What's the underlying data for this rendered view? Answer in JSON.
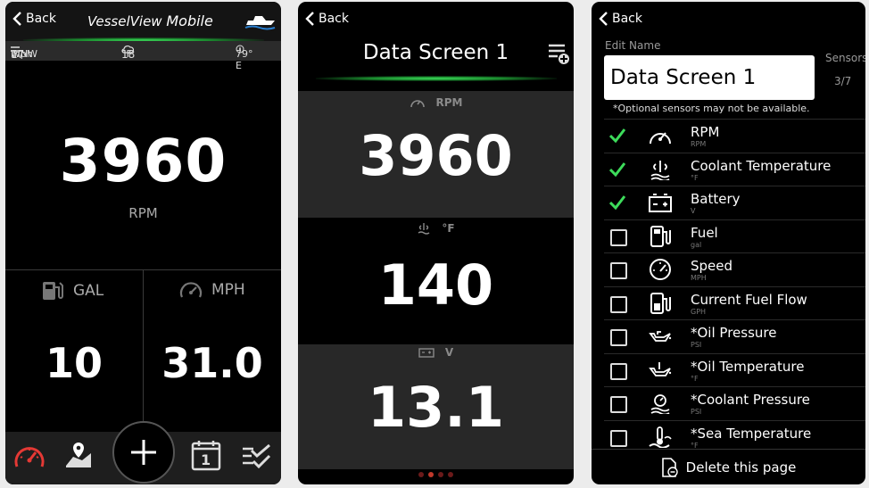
{
  "colors": {
    "accent_green": "#3ddc5b",
    "gauge_red": "#e53935",
    "dot_active": "#c0392b"
  },
  "panel1": {
    "back_label": "Back",
    "brand": {
      "part1": "VesselView",
      "part2": "Mobile"
    },
    "weather": {
      "wind": "17",
      "wind_unit": "mph",
      "wind_dir": "WNW",
      "air_temp": "18",
      "air_unit": "°F",
      "heading": "79° E"
    },
    "main": {
      "value": "3960",
      "unit": "RPM"
    },
    "left": {
      "label": "GAL",
      "value": "10"
    },
    "right": {
      "label": "MPH",
      "value": "31.0"
    },
    "toolbar_icons": [
      "gauge-icon",
      "map-pin-icon",
      "add-icon",
      "calendar-icon",
      "checklist-icon"
    ],
    "calendar_day": "1"
  },
  "panel2": {
    "back_label": "Back",
    "title": "Data Screen 1",
    "blocks": [
      {
        "label": "RPM",
        "value": "3960",
        "icon": "gauge-icon"
      },
      {
        "label": "°F",
        "value": "140",
        "icon": "coolant-temp-icon"
      },
      {
        "label": "V",
        "value": "13.1",
        "icon": "battery-icon"
      }
    ],
    "page_dots": 4,
    "active_dot": 1
  },
  "panel3": {
    "back_label": "Back",
    "edit_label": "Edit Name",
    "name_value": "Data Screen 1",
    "sensors_label": "Sensors",
    "sensors_count": "3/7",
    "note": "*Optional sensors may not be available.",
    "sensors": [
      {
        "name": "RPM",
        "unit": "RPM",
        "checked": true,
        "icon": "gauge-icon"
      },
      {
        "name": "Coolant Temperature",
        "unit": "°F",
        "checked": true,
        "icon": "coolant-temp-icon"
      },
      {
        "name": "Battery",
        "unit": "V",
        "checked": true,
        "icon": "battery-icon"
      },
      {
        "name": "Fuel",
        "unit": "gal",
        "checked": false,
        "icon": "fuel-pump-icon"
      },
      {
        "name": "Speed",
        "unit": "MPH",
        "checked": false,
        "icon": "speedometer-icon"
      },
      {
        "name": "Current Fuel Flow",
        "unit": "GPH",
        "checked": false,
        "icon": "fuel-flow-icon"
      },
      {
        "name": "*Oil Pressure",
        "unit": "PSI",
        "checked": false,
        "icon": "oil-can-icon"
      },
      {
        "name": "*Oil Temperature",
        "unit": "°F",
        "checked": false,
        "icon": "oil-temp-icon"
      },
      {
        "name": "*Coolant Pressure",
        "unit": "PSI",
        "checked": false,
        "icon": "coolant-pressure-icon"
      },
      {
        "name": "*Sea Temperature",
        "unit": "°F",
        "checked": false,
        "icon": "sea-temp-icon"
      }
    ],
    "delete_label": "Delete this page"
  }
}
